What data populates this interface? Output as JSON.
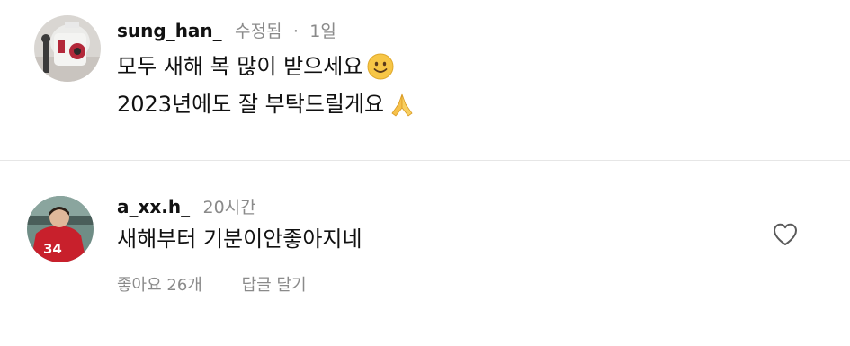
{
  "comments": [
    {
      "username": "sung_han_",
      "edited_label": "수정됨",
      "separator": "·",
      "time": "1일",
      "lines": [
        "모두 새해 복 많이 받으세요",
        "2023년에도 잘 부탁드릴게요"
      ],
      "emojis": [
        "smiling-face-emoji",
        "folded-hands-emoji"
      ],
      "avatar": "avatar-image"
    },
    {
      "username": "a_xx.h_",
      "time": "20시간",
      "lines": [
        "새해부터 기분이안좋아지네"
      ],
      "likes_label": "좋아요 26개",
      "reply_label": "답글 달기",
      "like_icon": "heart-outline-icon",
      "avatar": "avatar-image"
    }
  ],
  "colors": {
    "text_primary": "#111111",
    "text_secondary": "#8a8a8a",
    "divider": "#e6e6e6"
  }
}
